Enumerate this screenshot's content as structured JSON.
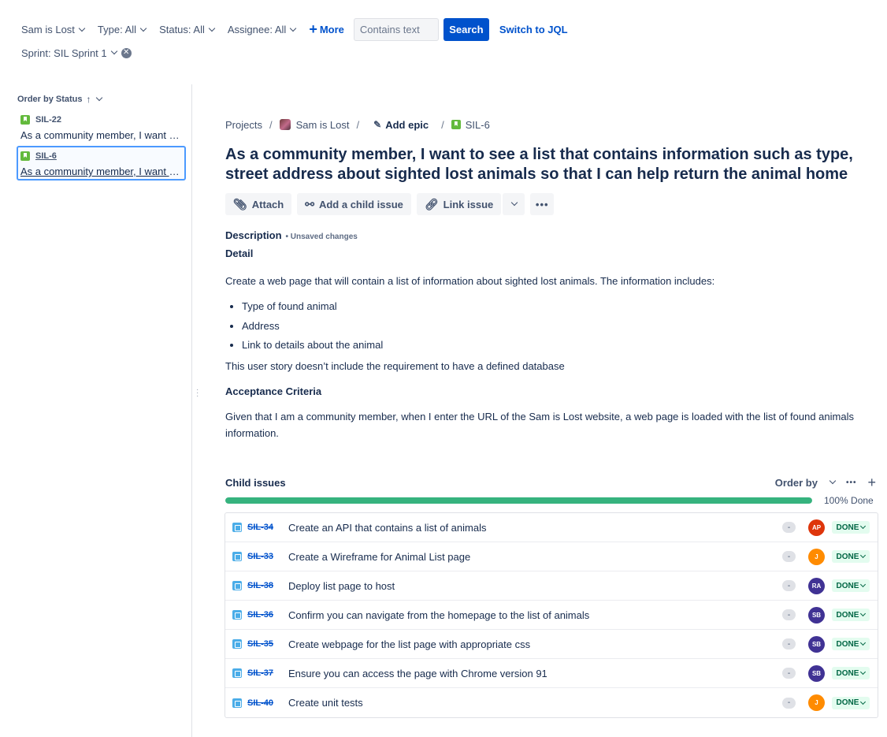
{
  "filters": {
    "project": "Sam is Lost",
    "type": "Type: All",
    "status": "Status: All",
    "assignee": "Assignee: All",
    "more": "More",
    "text_placeholder": "Contains text",
    "search": "Search",
    "switch_jql": "Switch to JQL",
    "sprint": "Sprint: SIL Sprint 1"
  },
  "issue_list": {
    "order_by": "Order by Status",
    "items": [
      {
        "key": "SIL-22",
        "summary": "As a community member, I want to see a list"
      },
      {
        "key": "SIL-6",
        "summary": "As a community member, I want to see a list"
      }
    ]
  },
  "breadcrumb": {
    "projects": "Projects",
    "project_name": "Sam is Lost",
    "add_epic": "Add epic",
    "issue_key": "SIL-6"
  },
  "issue": {
    "title": "As a community member, I want to see a list that contains information such as type, street address about sighted lost animals so that I can help return the animal home",
    "actions": {
      "attach": "Attach",
      "add_child": "Add a child issue",
      "link": "Link issue"
    },
    "description_label": "Description",
    "unsaved": "• Unsaved changes",
    "detail_heading": "Detail",
    "intro": "Create a web page that will contain a list of information about sighted lost animals. The information includes:",
    "bullets": [
      "Type of found animal",
      "Address",
      "Link to details about the animal"
    ],
    "note": "This user story doesn’t include the requirement to have a defined database",
    "acceptance_heading": "Acceptance Criteria",
    "acceptance": "Given that I am a community member, when I enter the URL of the Sam is Lost website, a web page is loaded with the list of found animals information."
  },
  "child_issues": {
    "title": "Child issues",
    "order_by": "Order by",
    "progress_percent": 100,
    "progress_label": "100% Done",
    "colors": {
      "progress": "#36b37e",
      "done_bg": "#e3fcef",
      "done_text": "#006644"
    },
    "rows": [
      {
        "key": "SIL-34",
        "summary": "Create an API that contains a list of animals",
        "priority": "-",
        "assignee": "AP",
        "avatar_color": "#de350b",
        "status": "DONE"
      },
      {
        "key": "SIL-33",
        "summary": "Create a Wireframe for Animal List page",
        "priority": "-",
        "assignee": "J",
        "avatar_color": "#ff8b00",
        "status": "DONE"
      },
      {
        "key": "SIL-38",
        "summary": "Deploy list page to host",
        "priority": "-",
        "assignee": "RA",
        "avatar_color": "#403294",
        "status": "DONE"
      },
      {
        "key": "SIL-36",
        "summary": "Confirm you can navigate from the homepage to the list of animals",
        "priority": "-",
        "assignee": "SB",
        "avatar_color": "#403294",
        "status": "DONE"
      },
      {
        "key": "SIL-35",
        "summary": "Create webpage for the list page with appropriate css",
        "priority": "-",
        "assignee": "SB",
        "avatar_color": "#403294",
        "status": "DONE"
      },
      {
        "key": "SIL-37",
        "summary": "Ensure you can access the page with Chrome version 91",
        "priority": "-",
        "assignee": "SB",
        "avatar_color": "#403294",
        "status": "DONE"
      },
      {
        "key": "SIL-40",
        "summary": "Create unit tests",
        "priority": "-",
        "assignee": "J",
        "avatar_color": "#ff8b00",
        "status": "DONE"
      }
    ]
  }
}
